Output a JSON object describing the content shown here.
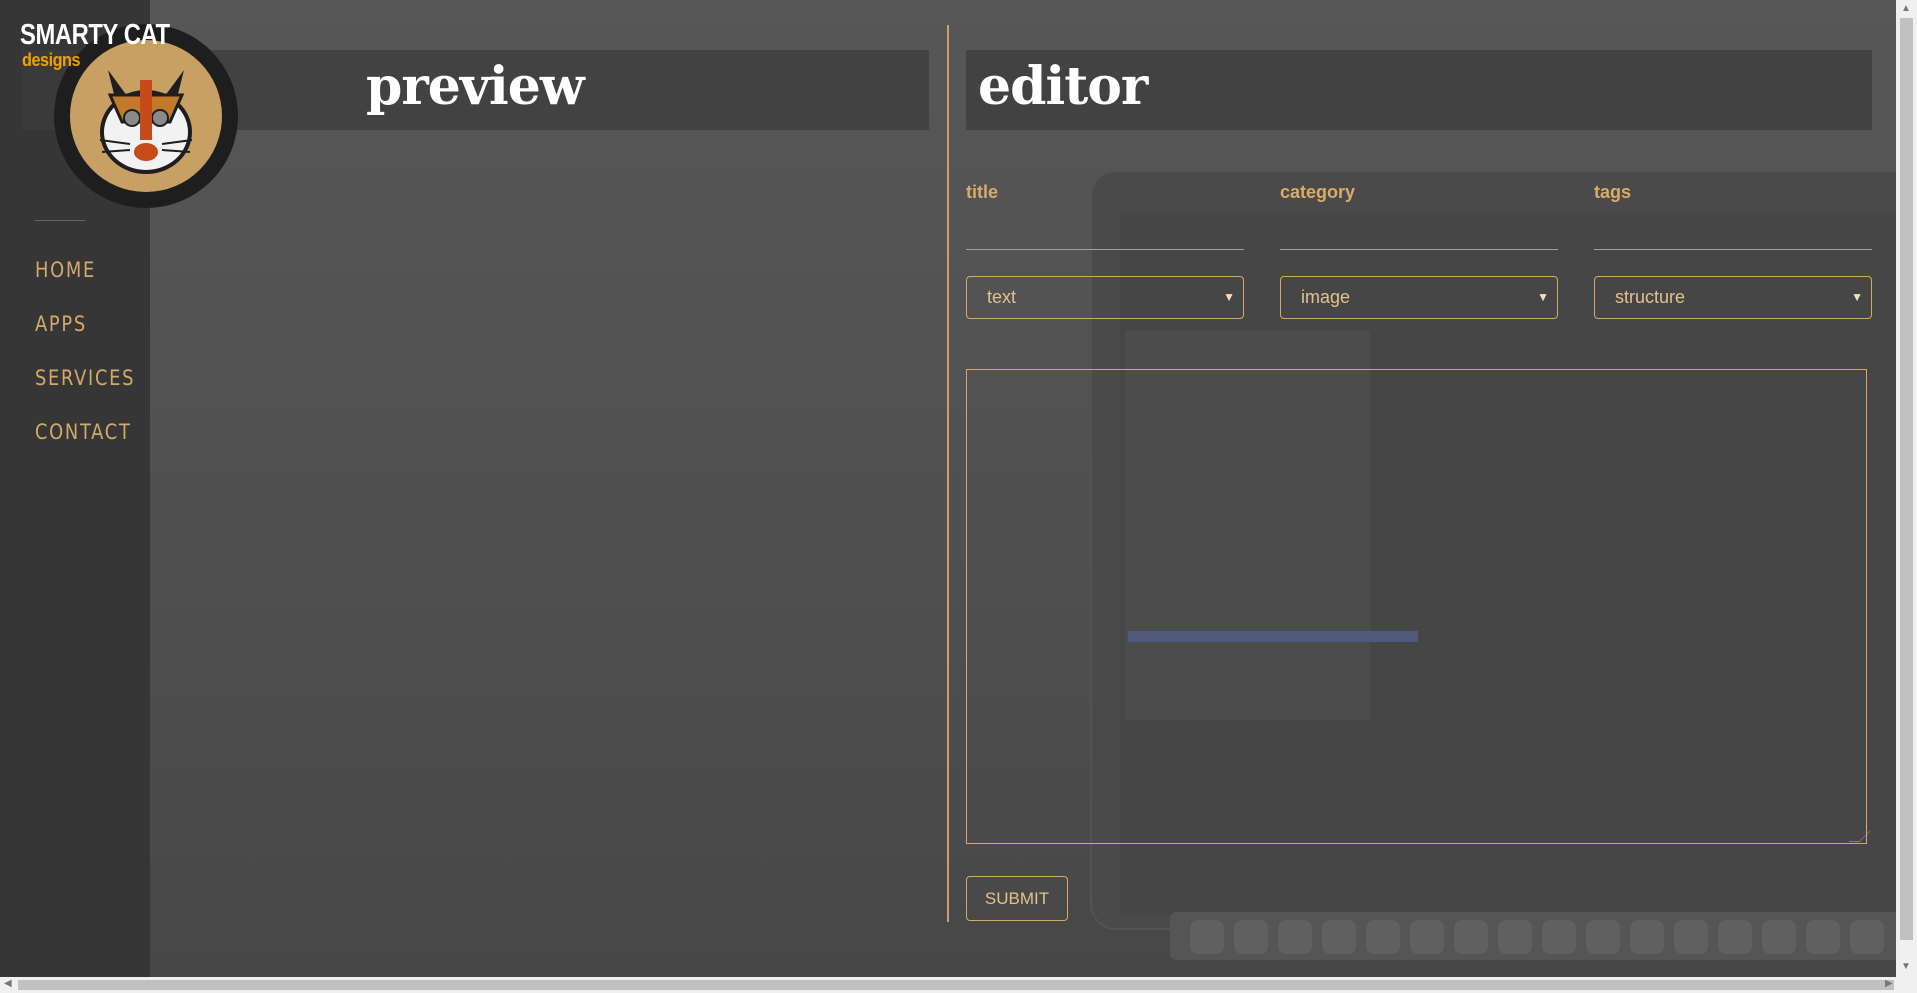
{
  "brand": {
    "name": "SMARTY CAT",
    "sub": "designs"
  },
  "nav": {
    "items": [
      "HOME",
      "APPS",
      "SERVICES",
      "CONTACT"
    ]
  },
  "preview": {
    "title": "preview"
  },
  "editor": {
    "title": "editor",
    "fields": {
      "title_label": "title",
      "category_label": "category",
      "tags_label": "tags",
      "title_value": "",
      "category_value": "",
      "tags_value": ""
    },
    "selects": {
      "first": "text",
      "second": "image",
      "third": "structure"
    },
    "body_value": "",
    "submit_label": "SUBMIT"
  },
  "colors": {
    "accent": "#d4a96a",
    "sidebar": "#363636",
    "heading": "#ffffff"
  }
}
